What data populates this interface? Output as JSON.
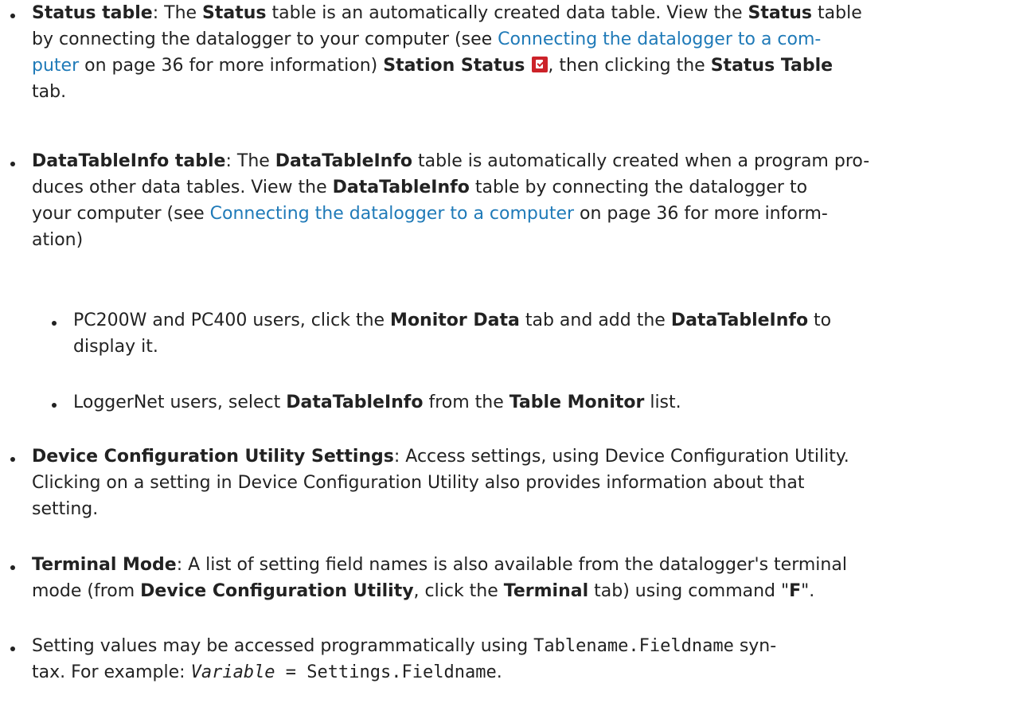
{
  "colors": {
    "link": "#1f7ab8",
    "text": "#222222",
    "icon": "#cc2229"
  },
  "items": [
    {
      "t1": "Status table",
      "t2": ": The ",
      "t3": "Status",
      "t4": " table is an automatically created data table. View the ",
      "t5": "Status",
      "t6": " table",
      "t7": "by connecting the datalogger to your computer (see ",
      "t8": "Connecting the datalogger to a com-",
      "t9": "puter",
      "t10": " on page 36 for more information) ",
      "t11": "Station Status",
      "icon": "station-status-icon",
      "t12": ", then clicking the ",
      "t13": "Status Table",
      "t14": "tab."
    },
    {
      "t1": "DataTableInfo table",
      "t2": ": The ",
      "t3": "DataTableInfo",
      "t4": " table is automatically created when a program pro-",
      "t5": "duces other data tables. View the ",
      "t6": "DataTableInfo",
      "t7": " table by connecting the datalogger to",
      "t8": "your computer (see ",
      "t9": "Connecting the datalogger to a computer",
      "t10": " on page 36 for more inform-",
      "t11": "ation)"
    },
    {
      "t1": "PC200W and PC400 users, click the ",
      "t2": "Monitor Data",
      "t3": " tab and add the ",
      "t4": "DataTableInfo",
      "t5": " to",
      "t6": "display it."
    },
    {
      "t1": "LoggerNet users, select ",
      "t2": "DataTableInfo",
      "t3": " from the ",
      "t4": "Table Monitor",
      "t5": " list."
    },
    {
      "t1": " Device Configuration Utility Settings",
      "t2": ": Access settings, using Device Configuration Utility.",
      "t3": "Clicking on a setting in Device Configuration Utility also provides information about that",
      "t4": "setting."
    },
    {
      "t1": "Terminal Mode",
      "t2": ": A list of setting field names is also available from the datalogger's terminal",
      "t3": "mode (from ",
      "t4": "Device Configuration Utility",
      "t5": ", click the ",
      "t6": "Terminal",
      "t7": " tab) using command \"",
      "t8": "F",
      "t9": "\"."
    },
    {
      "t1": "Setting values may be accessed programmatically using ",
      "t2": "Tablename.Fieldname",
      "t3": " syn-",
      "t4": "tax. For example: ",
      "t5": "Variable",
      "t6": " = Settings.Fieldname",
      "t7": "."
    }
  ]
}
